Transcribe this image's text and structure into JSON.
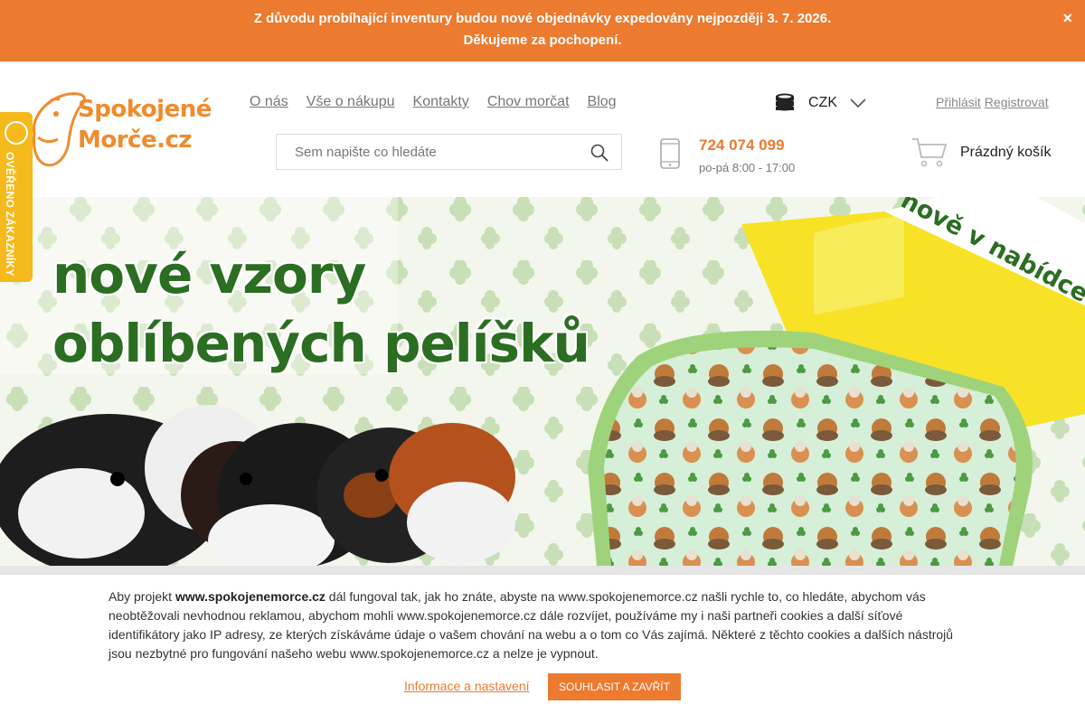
{
  "notice": {
    "line1": "Z důvodu probíhající inventury budou nové objednávky expedovány nejpozději 3. 7. 2026.",
    "line2": "Děkujeme za pochopení.",
    "close_label": "×"
  },
  "logo": {
    "line1": "Spokojené",
    "line2": "Morče.cz"
  },
  "nav": {
    "items": [
      "O nás",
      "Vše o nákupu",
      "Kontakty",
      "Chov morčat",
      "Blog"
    ]
  },
  "currency": {
    "value": "CZK",
    "icon": "coins-icon"
  },
  "auth": {
    "login": "Přihlásit",
    "register": "Registrovat"
  },
  "search": {
    "placeholder": "Sem napište co hledáte"
  },
  "contact": {
    "phone": "724 074 099",
    "hours": "po-pá 8:00 - 17:00"
  },
  "cart": {
    "label": "Prázdný košík"
  },
  "banner": {
    "title_line1": "nové vzory",
    "title_line2": "oblíbených pelíšků",
    "ribbon": "nově v nabídce"
  },
  "verified": {
    "label": "OVĚŘENO ZÁKAZNÍKY"
  },
  "cookie": {
    "intro": "Aby projekt ",
    "site_bold": "www.spokojenemorce.cz",
    "text": " dál fungoval tak, jak ho znáte, abyste na www.spokojenemorce.cz našli rychle to, co hledáte, abychom vás neobtěžovali nevhodnou reklamou, abychom mohli www.spokojenemorce.cz dále rozvíjet, používáme my i naši partneři cookies a další síťové identifikátory jako IP adresy, ze kterých získáváme údaje o vašem chování na webu a o tom co Vás zajímá. Některé z těchto cookies a dalších nástrojů jsou nezbytné pro fungování našeho webu www.spokojenemorce.cz a nelze je vypnout.",
    "settings_link": "Informace a nastavení",
    "accept_button": "SOUHLASIT A ZAVŘÍT"
  },
  "colors": {
    "accent": "#ec7a2f",
    "green": "#2b6e22",
    "badge": "#f6b91b"
  }
}
